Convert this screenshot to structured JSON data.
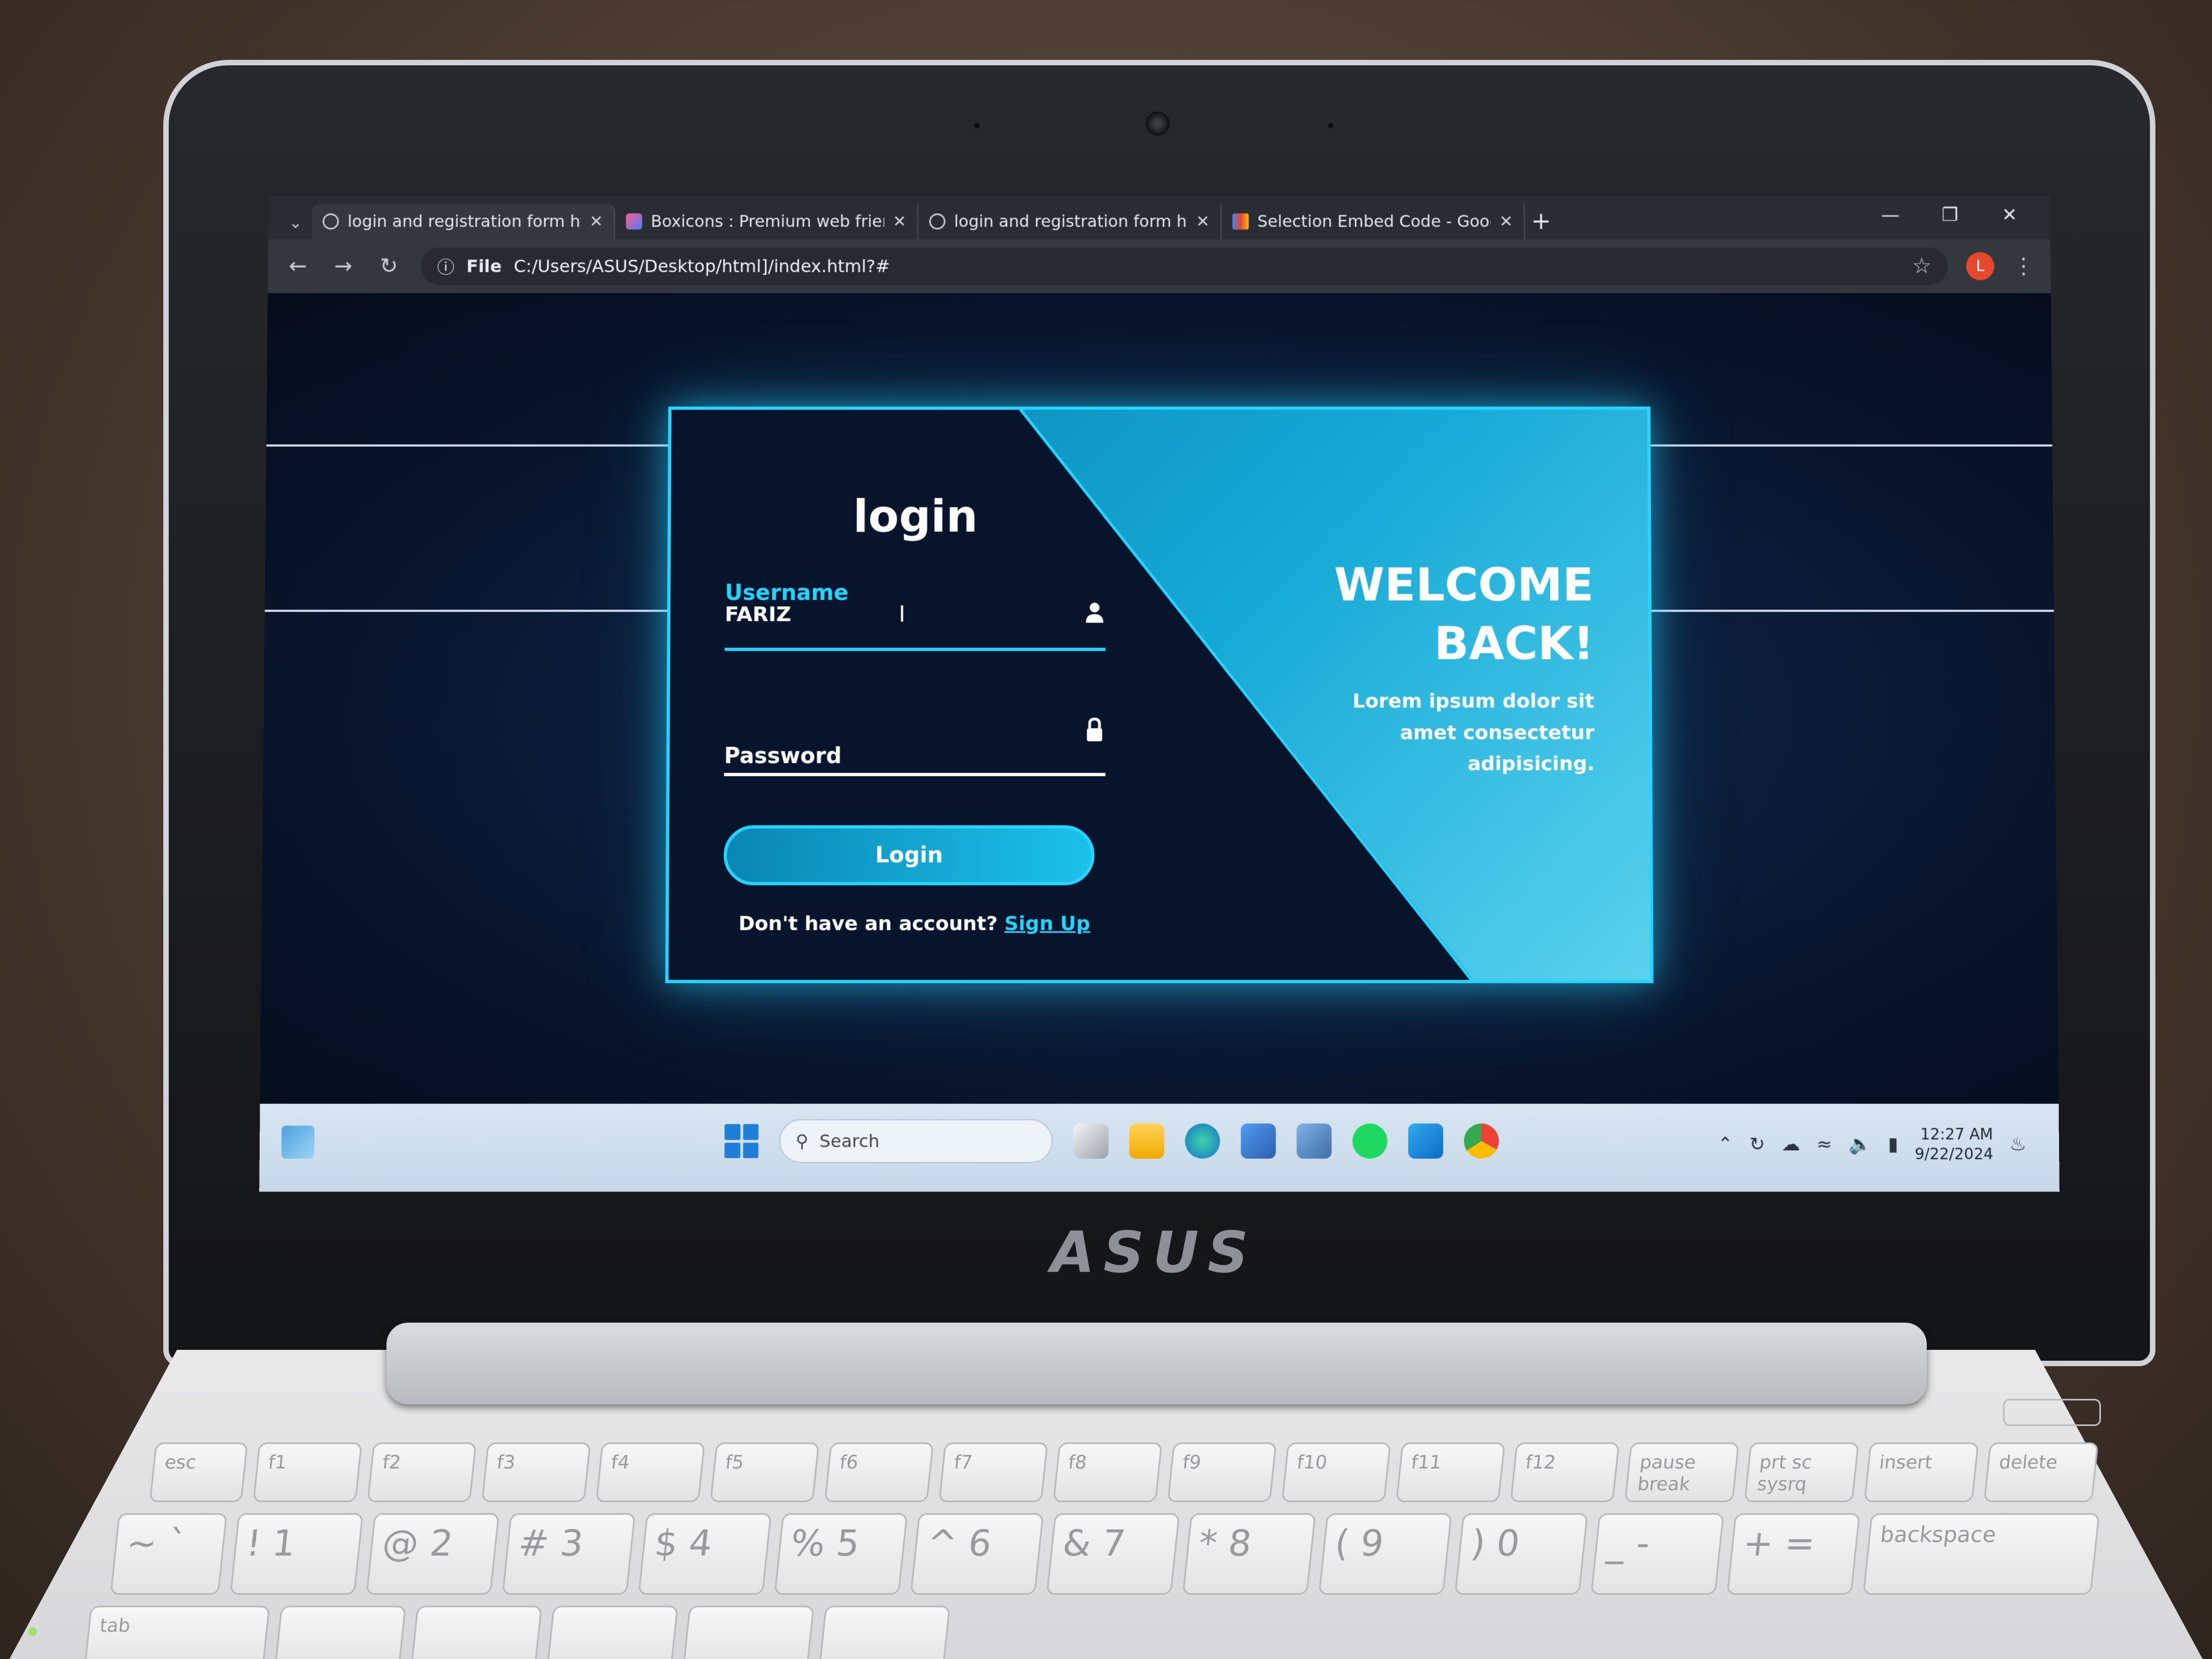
{
  "browser": {
    "tabs": [
      {
        "title": "login and registration form htm",
        "active": true,
        "favicon": "globe-icon"
      },
      {
        "title": "Boxicons : Premium web friendl",
        "active": false,
        "favicon": "boxicons-logo-icon"
      },
      {
        "title": "login and registration form htm",
        "active": false,
        "favicon": "globe-icon"
      },
      {
        "title": "Selection Embed Code - Googl",
        "active": false,
        "favicon": "google-fonts-icon"
      }
    ],
    "new_tab": "+",
    "address": {
      "scheme_label": "File",
      "url": "C:/Users/ASUS/Desktop/html]/index.html?#"
    },
    "profile_initial": "L"
  },
  "login_form": {
    "title": "login",
    "username": {
      "label": "Username",
      "value": "FARIZ"
    },
    "password": {
      "label": "Password",
      "value": ""
    },
    "submit_label": "Login",
    "signup_prompt": "Don't have an account?",
    "signup_link": "Sign Up"
  },
  "welcome_panel": {
    "title_line1": "WELCOME",
    "title_line2": "BACK!",
    "text": "Lorem ipsum dolor sit amet consectetur adipisicing."
  },
  "taskbar": {
    "search_placeholder": "Search",
    "time": "12:27 AM",
    "date": "9/22/2024"
  },
  "hardware": {
    "brand": "ASUS",
    "keys_fn": [
      "esc",
      "f1",
      "f2",
      "f3",
      "f4",
      "f5",
      "f6",
      "f7",
      "f8",
      "f9",
      "f10",
      "f11",
      "f12",
      "pause break",
      "prt sc sysrq",
      "insert",
      "delete"
    ],
    "keys_num": [
      "~ `",
      "! 1",
      "@ 2",
      "# 3",
      "$ 4",
      "% 5",
      "^ 6",
      "& 7",
      "* 8",
      "( 9",
      ") 0",
      "_ -",
      "+ =",
      "backspace"
    ],
    "key_tab": "tab"
  },
  "colors": {
    "accent": "#27d3ff",
    "panel": "#16a9d6",
    "background": "#0b1b38"
  }
}
